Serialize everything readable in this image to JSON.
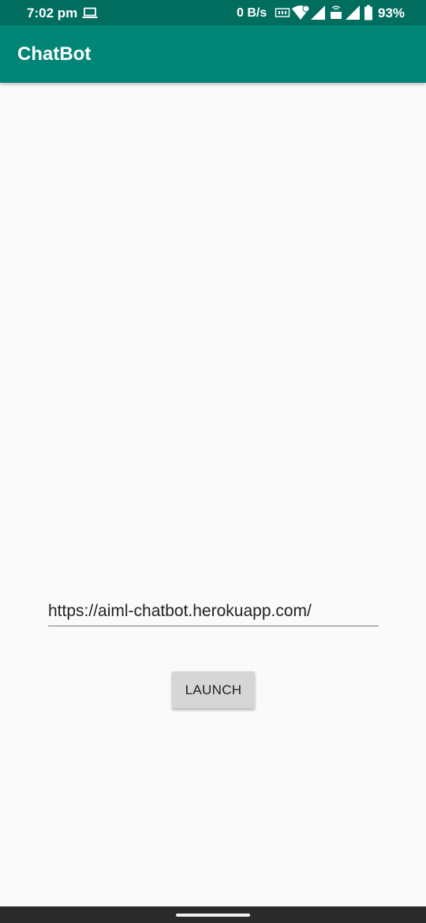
{
  "status_bar": {
    "time": "7:02 pm",
    "network_speed": "0 B/s",
    "battery": "93%",
    "icons": [
      "laptop-icon",
      "hd-icon",
      "wifi-icon",
      "signal-icon",
      "volte-icon",
      "signal-icon-2",
      "battery-icon"
    ]
  },
  "app_bar": {
    "title": "ChatBot"
  },
  "url_field": {
    "value": "https://aiml-chatbot.herokuapp.com/"
  },
  "launch_button": {
    "label": "LAUNCH"
  },
  "colors": {
    "status_bar": "#016d5f",
    "app_bar": "#008577",
    "background": "#fafafa",
    "button": "#d6d6d6",
    "nav_bar": "#2a2a2a"
  }
}
